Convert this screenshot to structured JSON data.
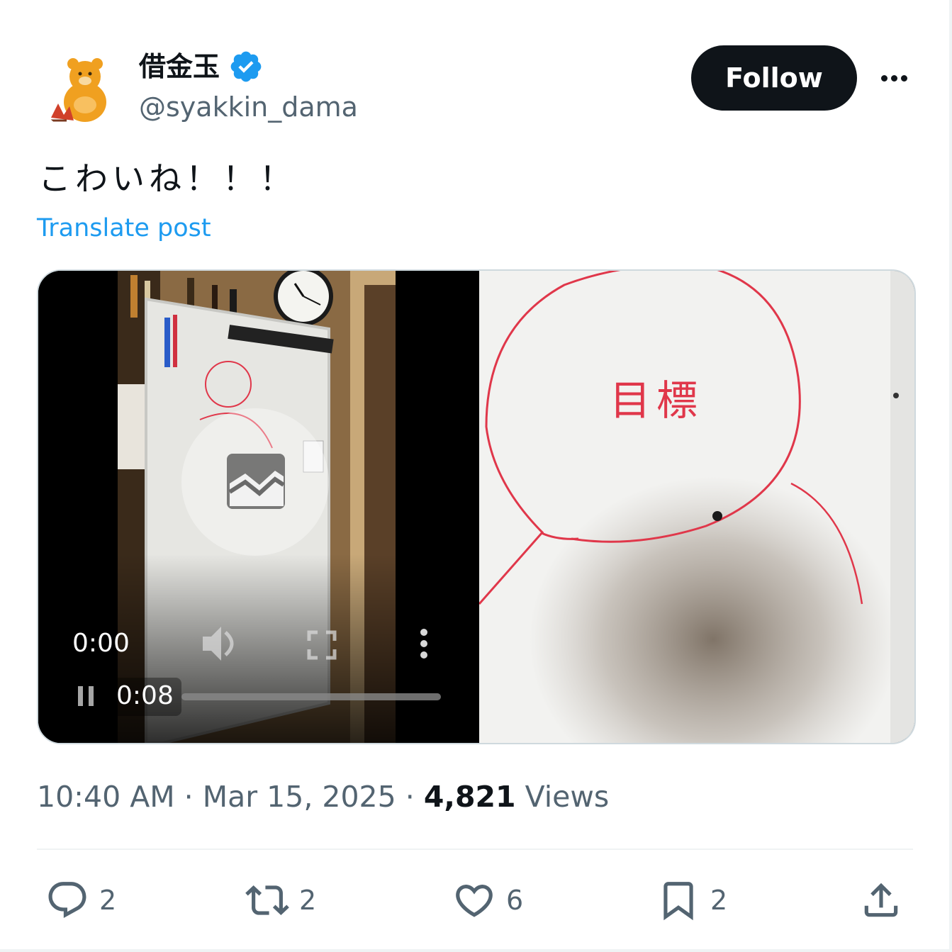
{
  "author": {
    "display_name": "借金玉",
    "handle": "@syakkin_dama",
    "verified": true
  },
  "follow_button": {
    "label": "Follow"
  },
  "post": {
    "text": "こわいね！！！",
    "translate_label": "Translate post"
  },
  "video": {
    "current_time": "0:00",
    "duration": "0:08",
    "progress_fraction": 0.0,
    "whiteboard_text": "目標"
  },
  "meta": {
    "time": "10:40 AM",
    "separator": "·",
    "date": "Mar 15, 2025",
    "views_count": "4,821",
    "views_label": "Views"
  },
  "actions": {
    "replies": "2",
    "reposts": "2",
    "likes": "6",
    "bookmarks": "2"
  },
  "colors": {
    "accent": "#1d9bf0",
    "text_primary": "#0f1419",
    "text_secondary": "#536471",
    "marker_red": "#e0374a"
  }
}
